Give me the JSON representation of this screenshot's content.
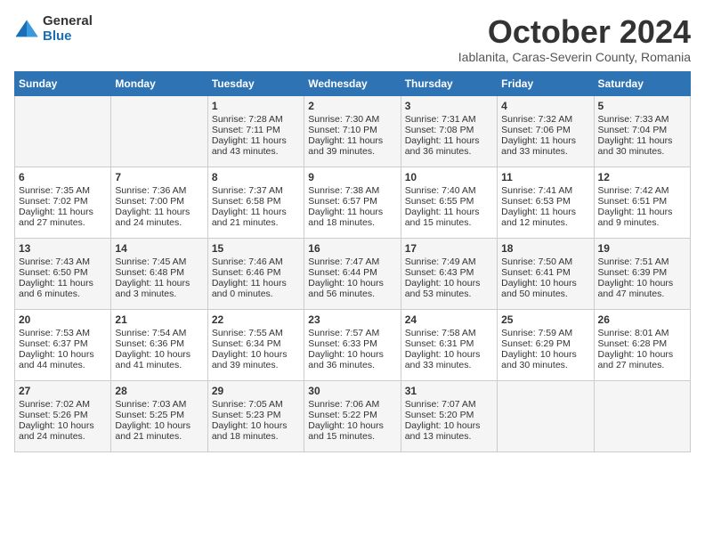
{
  "header": {
    "logo_general": "General",
    "logo_blue": "Blue",
    "month": "October 2024",
    "location": "Iablanita, Caras-Severin County, Romania"
  },
  "columns": [
    "Sunday",
    "Monday",
    "Tuesday",
    "Wednesday",
    "Thursday",
    "Friday",
    "Saturday"
  ],
  "weeks": [
    [
      {
        "day": "",
        "data": ""
      },
      {
        "day": "",
        "data": ""
      },
      {
        "day": "1",
        "data": "Sunrise: 7:28 AM\nSunset: 7:11 PM\nDaylight: 11 hours and 43 minutes."
      },
      {
        "day": "2",
        "data": "Sunrise: 7:30 AM\nSunset: 7:10 PM\nDaylight: 11 hours and 39 minutes."
      },
      {
        "day": "3",
        "data": "Sunrise: 7:31 AM\nSunset: 7:08 PM\nDaylight: 11 hours and 36 minutes."
      },
      {
        "day": "4",
        "data": "Sunrise: 7:32 AM\nSunset: 7:06 PM\nDaylight: 11 hours and 33 minutes."
      },
      {
        "day": "5",
        "data": "Sunrise: 7:33 AM\nSunset: 7:04 PM\nDaylight: 11 hours and 30 minutes."
      }
    ],
    [
      {
        "day": "6",
        "data": "Sunrise: 7:35 AM\nSunset: 7:02 PM\nDaylight: 11 hours and 27 minutes."
      },
      {
        "day": "7",
        "data": "Sunrise: 7:36 AM\nSunset: 7:00 PM\nDaylight: 11 hours and 24 minutes."
      },
      {
        "day": "8",
        "data": "Sunrise: 7:37 AM\nSunset: 6:58 PM\nDaylight: 11 hours and 21 minutes."
      },
      {
        "day": "9",
        "data": "Sunrise: 7:38 AM\nSunset: 6:57 PM\nDaylight: 11 hours and 18 minutes."
      },
      {
        "day": "10",
        "data": "Sunrise: 7:40 AM\nSunset: 6:55 PM\nDaylight: 11 hours and 15 minutes."
      },
      {
        "day": "11",
        "data": "Sunrise: 7:41 AM\nSunset: 6:53 PM\nDaylight: 11 hours and 12 minutes."
      },
      {
        "day": "12",
        "data": "Sunrise: 7:42 AM\nSunset: 6:51 PM\nDaylight: 11 hours and 9 minutes."
      }
    ],
    [
      {
        "day": "13",
        "data": "Sunrise: 7:43 AM\nSunset: 6:50 PM\nDaylight: 11 hours and 6 minutes."
      },
      {
        "day": "14",
        "data": "Sunrise: 7:45 AM\nSunset: 6:48 PM\nDaylight: 11 hours and 3 minutes."
      },
      {
        "day": "15",
        "data": "Sunrise: 7:46 AM\nSunset: 6:46 PM\nDaylight: 11 hours and 0 minutes."
      },
      {
        "day": "16",
        "data": "Sunrise: 7:47 AM\nSunset: 6:44 PM\nDaylight: 10 hours and 56 minutes."
      },
      {
        "day": "17",
        "data": "Sunrise: 7:49 AM\nSunset: 6:43 PM\nDaylight: 10 hours and 53 minutes."
      },
      {
        "day": "18",
        "data": "Sunrise: 7:50 AM\nSunset: 6:41 PM\nDaylight: 10 hours and 50 minutes."
      },
      {
        "day": "19",
        "data": "Sunrise: 7:51 AM\nSunset: 6:39 PM\nDaylight: 10 hours and 47 minutes."
      }
    ],
    [
      {
        "day": "20",
        "data": "Sunrise: 7:53 AM\nSunset: 6:37 PM\nDaylight: 10 hours and 44 minutes."
      },
      {
        "day": "21",
        "data": "Sunrise: 7:54 AM\nSunset: 6:36 PM\nDaylight: 10 hours and 41 minutes."
      },
      {
        "day": "22",
        "data": "Sunrise: 7:55 AM\nSunset: 6:34 PM\nDaylight: 10 hours and 39 minutes."
      },
      {
        "day": "23",
        "data": "Sunrise: 7:57 AM\nSunset: 6:33 PM\nDaylight: 10 hours and 36 minutes."
      },
      {
        "day": "24",
        "data": "Sunrise: 7:58 AM\nSunset: 6:31 PM\nDaylight: 10 hours and 33 minutes."
      },
      {
        "day": "25",
        "data": "Sunrise: 7:59 AM\nSunset: 6:29 PM\nDaylight: 10 hours and 30 minutes."
      },
      {
        "day": "26",
        "data": "Sunrise: 8:01 AM\nSunset: 6:28 PM\nDaylight: 10 hours and 27 minutes."
      }
    ],
    [
      {
        "day": "27",
        "data": "Sunrise: 7:02 AM\nSunset: 5:26 PM\nDaylight: 10 hours and 24 minutes."
      },
      {
        "day": "28",
        "data": "Sunrise: 7:03 AM\nSunset: 5:25 PM\nDaylight: 10 hours and 21 minutes."
      },
      {
        "day": "29",
        "data": "Sunrise: 7:05 AM\nSunset: 5:23 PM\nDaylight: 10 hours and 18 minutes."
      },
      {
        "day": "30",
        "data": "Sunrise: 7:06 AM\nSunset: 5:22 PM\nDaylight: 10 hours and 15 minutes."
      },
      {
        "day": "31",
        "data": "Sunrise: 7:07 AM\nSunset: 5:20 PM\nDaylight: 10 hours and 13 minutes."
      },
      {
        "day": "",
        "data": ""
      },
      {
        "day": "",
        "data": ""
      }
    ]
  ]
}
